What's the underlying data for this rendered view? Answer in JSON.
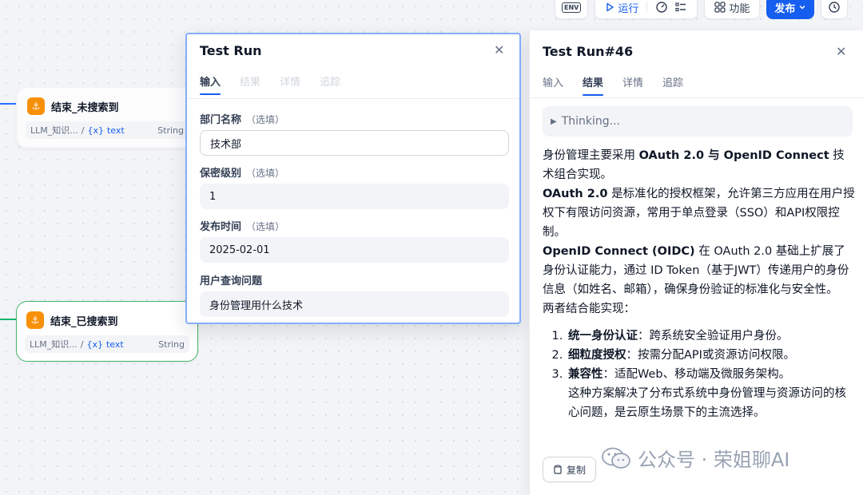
{
  "toolbar": {
    "env_label": "ENV",
    "run_label": "运行",
    "features_label": "功能",
    "publish_label": "发布"
  },
  "canvas": {
    "nodes": [
      {
        "title": "结束_未搜索到",
        "var_source": "LLM_知识...",
        "var_name": "text",
        "var_type": "String"
      },
      {
        "title": "结束_已搜索到",
        "var_source": "LLM_知识...",
        "var_name": "text",
        "var_type": "String"
      }
    ]
  },
  "test_run": {
    "title": "Test Run",
    "tabs": [
      "输入",
      "结果",
      "详情",
      "追踪"
    ],
    "optional_label": "（选填）",
    "fields": [
      {
        "label": "部门名称",
        "optional": true,
        "value": "技术部"
      },
      {
        "label": "保密级别",
        "optional": true,
        "value": "1"
      },
      {
        "label": "发布时间",
        "optional": true,
        "value": "2025-02-01"
      },
      {
        "label": "用户查询问题",
        "optional": false,
        "value": "身份管理用什么技术"
      }
    ]
  },
  "result_panel": {
    "title": "Test Run#46",
    "tabs": [
      "输入",
      "结果",
      "详情",
      "追踪"
    ],
    "thinking_label": "Thinking...",
    "p1_pre": "身份管理主要采用 ",
    "p1_bold": "OAuth 2.0 与 OpenID Connect",
    "p1_post": " 技术组合实现。",
    "p2_bold": "OAuth 2.0",
    "p2_post": " 是标准化的授权框架，允许第三方应用在用户授权下有限访问资源，常用于单点登录（SSO）和API权限控制。",
    "p3_bold": "OpenID Connect (OIDC)",
    "p3_post": " 在 OAuth 2.0 基础上扩展了身份认证能力，通过 ID Token（基于JWT）传递用户的身份信息（如姓名、邮箱），确保身份验证的标准化与安全性。",
    "p4": "两者结合能实现：",
    "list": [
      {
        "bold": "统一身份认证",
        "text": "：跨系统安全验证用户身份。"
      },
      {
        "bold": "细粒度授权",
        "text": "：按需分配API或资源访问权限。"
      },
      {
        "bold": "兼容性",
        "text": "：适配Web、移动端及微服务架构。"
      }
    ],
    "conclusion": "这种方案解决了分布式系统中身份管理与资源访问的核心问题，是云原生场景下的主流选择。",
    "copy_label": "复制"
  },
  "watermark": {
    "text": "公众号 · 荣姐聊AI"
  },
  "colors": {
    "accent": "#155eef",
    "node_icon": "#f79009",
    "success": "#47b36a"
  }
}
